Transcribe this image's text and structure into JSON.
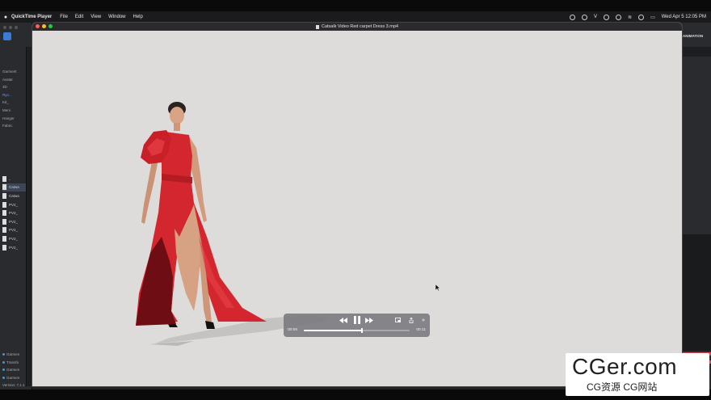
{
  "menubar": {
    "app_name": "QuickTime Player",
    "items": [
      "File",
      "Edit",
      "View",
      "Window",
      "Help"
    ],
    "clock": "Wed Apr 5  12:05 PM"
  },
  "window": {
    "title": "Catsalk Video Red carpet Dress 3.mp4"
  },
  "player": {
    "current_time": "00:06",
    "duration": "00:11",
    "progress": 0.55
  },
  "background_app": {
    "right_label": "ANIMATION",
    "tree": [
      "Garment",
      "Avatar",
      "3D",
      "Ryo...",
      "Kit_",
      "Meni",
      "Hanger",
      "Fabric"
    ],
    "files": [
      "..",
      "Catwa",
      "Catwa",
      "PV2_",
      "PV2_",
      "PV2_",
      "PV2_",
      "PV2_",
      "PV2_"
    ],
    "bottom": [
      "Garmen",
      "Transfo",
      "Garmen",
      "Garmen"
    ],
    "version": "Version: 7.1.1"
  },
  "watermark": {
    "main": "CGer.com",
    "sub": "CG资源  CG网站"
  },
  "colors": {
    "dress": "#d4262e",
    "video_bg": "#dddcda"
  }
}
